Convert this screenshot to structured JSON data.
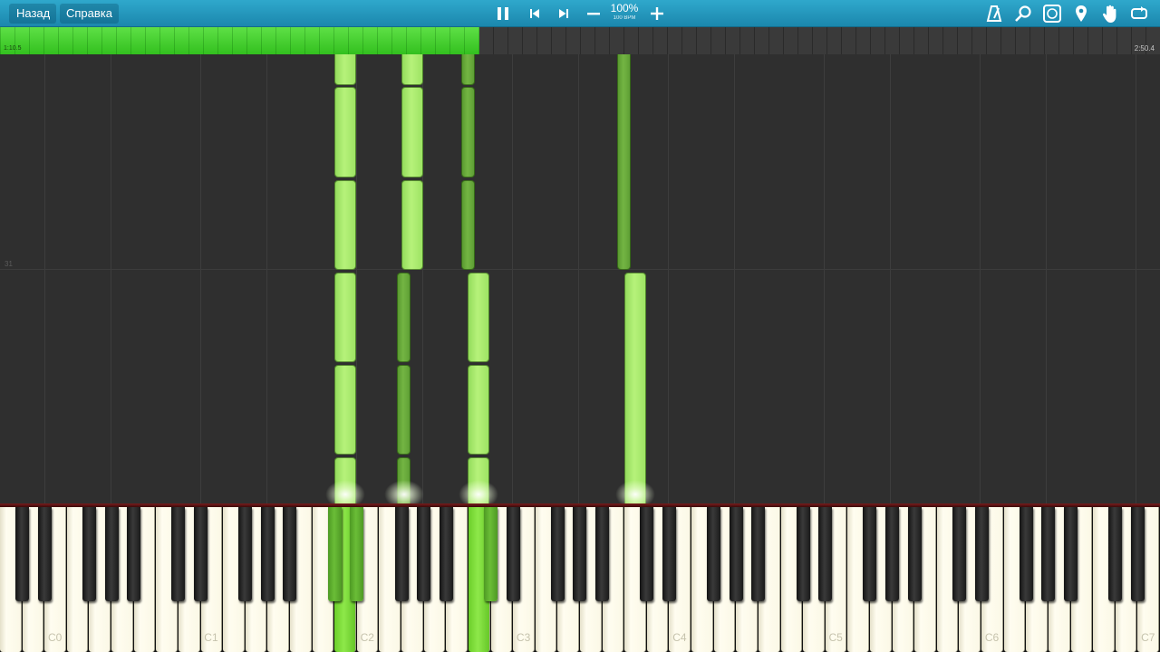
{
  "toolbar": {
    "back_label": "Назад",
    "help_label": "Справка",
    "speed_percent": "100%",
    "speed_bpm": "100 BPM",
    "icons": [
      "pause-icon",
      "skip-back-icon",
      "skip-forward-icon",
      "minus-icon",
      "plus-icon",
      "metronome-icon",
      "search-icon",
      "keyboard-labels-icon",
      "location-pin-icon",
      "hand-icon",
      "loop-icon"
    ]
  },
  "timeline": {
    "current_time": "1:10.5",
    "total_time": "2:50.4",
    "progress_fraction": 0.413
  },
  "roll": {
    "measure_number": "31"
  },
  "keyboard": {
    "octave_labels": [
      "C0",
      "C1",
      "C2",
      "C3",
      "C4",
      "C5",
      "C6",
      "C7"
    ],
    "colors": {
      "note_light": "#a6ea6c",
      "note_dark": "#6aad3c",
      "key_active": "#7fdc3c"
    }
  }
}
